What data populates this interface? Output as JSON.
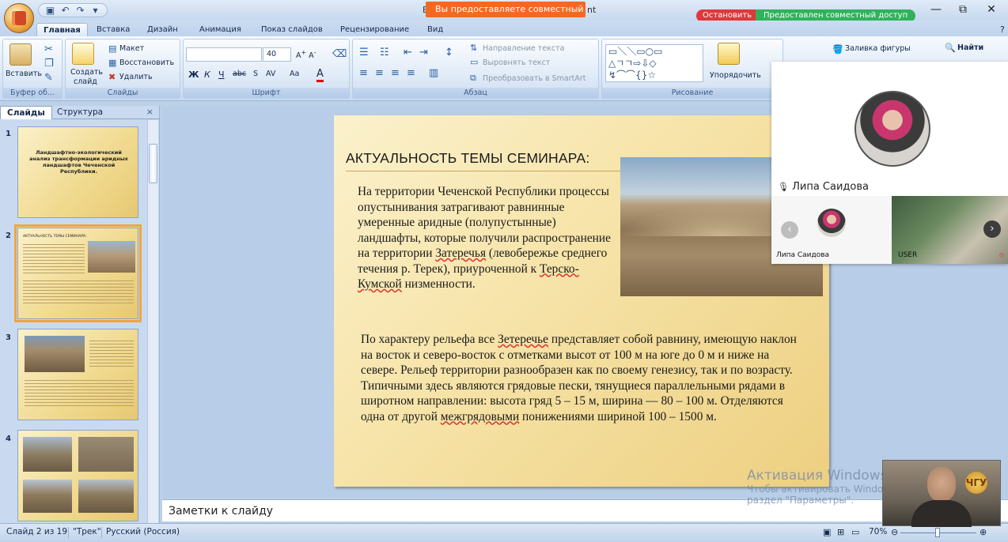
{
  "window": {
    "share_banner": "Вы предоставляете совместный д...",
    "title_lead": "Е",
    "title_tail": "nt",
    "stop_button": "Остановить",
    "shared_label": "Предоставлен совместный доступ",
    "controls": {
      "minimize": "—",
      "maximize": "⧉",
      "close": "✕"
    }
  },
  "ribbon": {
    "tabs": [
      "Главная",
      "Вставка",
      "Дизайн",
      "Анимация",
      "Показ слайдов",
      "Рецензирование",
      "Вид"
    ],
    "active_tab": "Главная",
    "clipboard": {
      "paste": "Вставить",
      "label": "Буфер об..."
    },
    "slides_group": {
      "new_slide_line1": "Создать",
      "new_slide_line2": "слайд",
      "layout": "Макет",
      "restore": "Восстановить",
      "delete": "Удалить",
      "label": "Слайды"
    },
    "font_group": {
      "font_size": "40",
      "label": "Шрифт"
    },
    "paragraph_group": {
      "text_direction": "Направление текста",
      "align_text": "Выровнять текст",
      "smartart": "Преобразовать в SmartArt",
      "label": "Абзац"
    },
    "drawing_group": {
      "arrange": "Упорядочить",
      "shape_fill": "Заливка фигуры",
      "label": "Рисование"
    },
    "editing_group": {
      "find": "Найти"
    }
  },
  "left_panel": {
    "tabs": [
      "Слайды",
      "Структура"
    ],
    "close": "×",
    "slides": [
      {
        "num": "1",
        "title": "Ландшафтно-экологический анализ трансформации аридных ландшафтов Чеченской Республики."
      },
      {
        "num": "2",
        "title": "АКТУАЛЬНОСТЬ ТЕМЫ СЕМИНАРА:"
      },
      {
        "num": "3",
        "title": ""
      },
      {
        "num": "4",
        "title": ""
      }
    ]
  },
  "slide": {
    "title": "АКТУАЛЬНОСТЬ ТЕМЫ СЕМИНАРА:",
    "para1": {
      "part1": "На территории Чеченской Республики процессы опустынивания затрагивают равнинные умеренные аридные (полупустынные) ландшафты, которые получили распространение на территории ",
      "underline1": "Затеречья",
      "part2": " (левобережье среднего течения р. Терек), приуроченной к ",
      "underline2": "Терско-Кумской",
      "part3": " низменности."
    },
    "para2": {
      "part1": "По характеру рельефа все ",
      "underline1": "Зетеречье",
      "part2": " представляет собой равнину, имеющую наклон на восток и северо-восток с отметками высот от 100 м на юге до 0 м и ниже на севере. Рельеф территории разнообразен как по своему генезису, так и по возрасту. Типичными здесь являются грядовые пески, тянущиеся параллельными рядами в широтном направлении: высота гряд 5 – 15 м, ширина — 80 – 100 м. Отделяются одна от другой ",
      "underline2": "межгрядовыми",
      "part3": " понижениями шириной 100 – 1500 м."
    }
  },
  "notes": {
    "placeholder": "Заметки к слайду"
  },
  "status": {
    "slide_counter": "Слайд 2 из 19",
    "theme": "\"Трек\"",
    "language": "Русский (Россия)",
    "zoom": "70%"
  },
  "activation": {
    "line1": "Активация Windows",
    "line2": "Чтобы активировать Windows, перейдите в",
    "line3": "раздел \"Параметры\"."
  },
  "call": {
    "main_name": "Липа Саидова",
    "tile1_name": "Липа Саидова",
    "tile2_name": "USER"
  },
  "colors": {
    "accent_orange": "#f26a21",
    "stop_red": "#e0383a",
    "shared_green": "#2fb35a",
    "ribbon_blue": "#c6d9f0",
    "slide_gold": "#f6e3a7"
  }
}
